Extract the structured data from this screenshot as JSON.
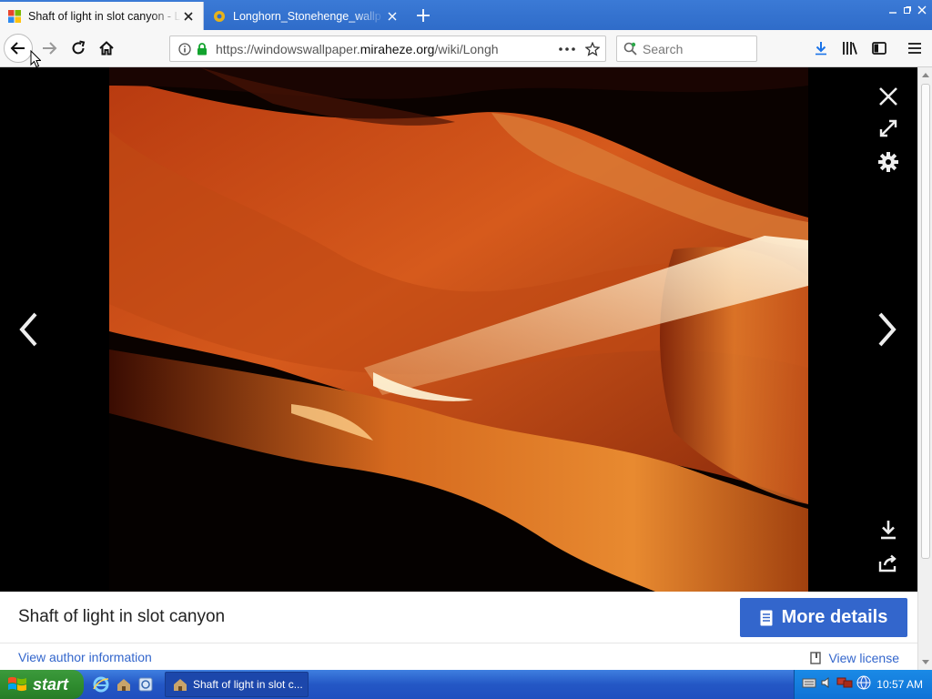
{
  "browser": {
    "tabs": [
      {
        "label": "Shaft of light in slot canyon - L",
        "active": true
      },
      {
        "label": "Longhorn_Stonehenge_wallp",
        "active": false
      }
    ],
    "url": {
      "prefix": "https://windowswallpaper.",
      "domain": "miraheze.org",
      "path": "/wiki/Longh"
    },
    "search_placeholder": "Search"
  },
  "viewer": {
    "caption": "Shaft of light in slot canyon",
    "more_details_label": "More details",
    "author_link": "View author information",
    "license_link": "View license"
  },
  "taskbar": {
    "start_label": "start",
    "task_label": "Shaft of light in slot c...",
    "clock": "10:57 AM"
  },
  "colors": {
    "accent": "#3366cc",
    "tabstrip": "#2f6cc9",
    "start_green": "#2e8b2e",
    "tray_blue": "#0f72d6"
  },
  "icons": {
    "nav": [
      "back-arrow-icon",
      "forward-arrow-icon",
      "reload-icon",
      "home-icon"
    ],
    "toolbar": [
      "download-icon",
      "library-icon",
      "sidebar-icon",
      "menu-icon"
    ],
    "viewer": [
      "close-icon",
      "fullscreen-icon",
      "settings-gear-icon",
      "prev-chevron-icon",
      "next-chevron-icon",
      "download-icon",
      "share-icon"
    ]
  }
}
